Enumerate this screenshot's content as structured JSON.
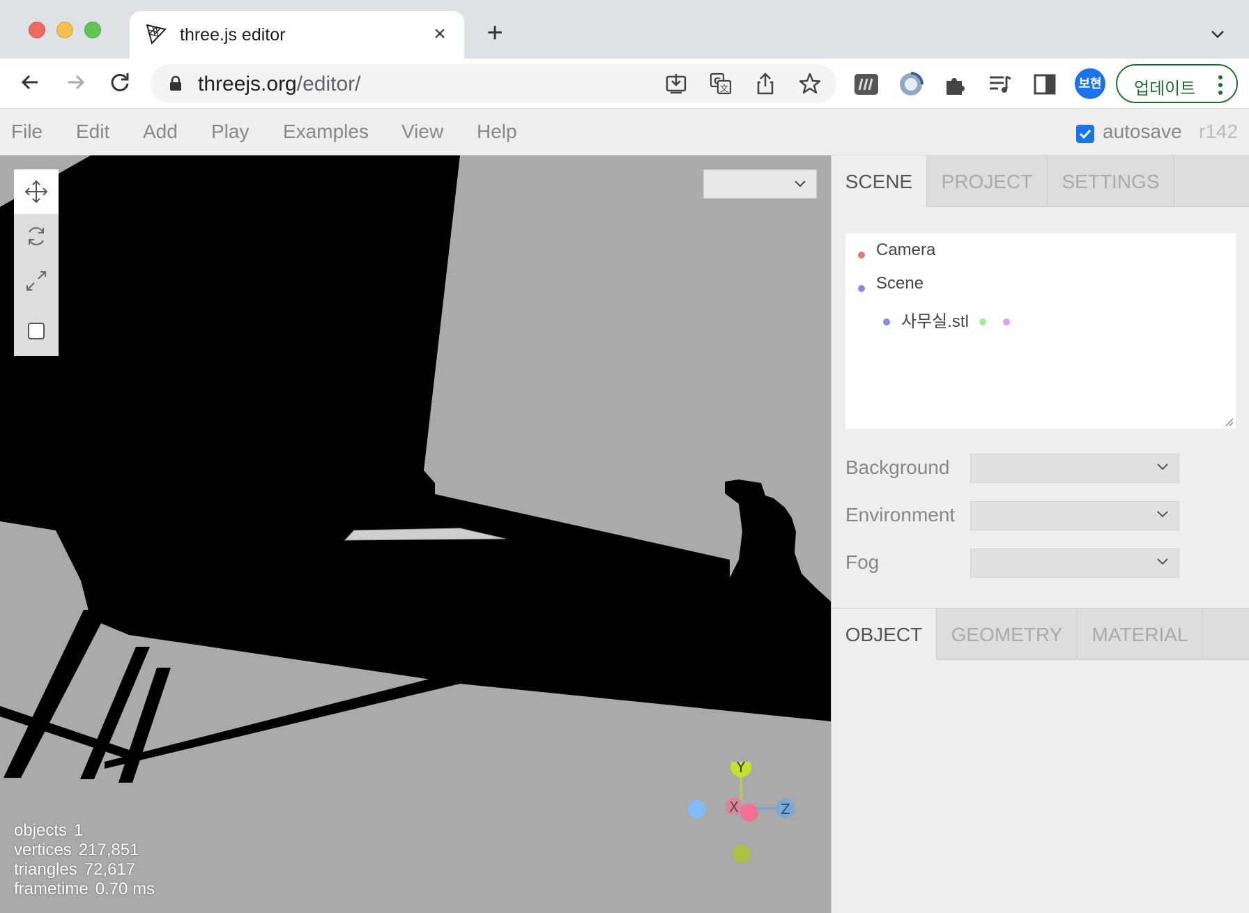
{
  "browser": {
    "tab_title": "three.js editor",
    "url_host": "threejs.org",
    "url_path": "/editor/",
    "profile_initials": "보현",
    "update_label": "업데이트"
  },
  "menu": {
    "items": [
      "File",
      "Edit",
      "Add",
      "Play",
      "Examples",
      "View",
      "Help"
    ],
    "autosave_label": "autosave",
    "autosave_checked": true,
    "revision": "r142"
  },
  "viewport": {
    "tools": [
      "translate",
      "rotate",
      "scale",
      "local"
    ],
    "camera_select_value": "",
    "info": [
      {
        "label": "objects",
        "value": "1"
      },
      {
        "label": "vertices",
        "value": "217,851"
      },
      {
        "label": "triangles",
        "value": "72,617"
      },
      {
        "label": "frametime",
        "value": "0.70 ms"
      }
    ],
    "gizmo": {
      "x_label": "X",
      "y_label": "Y",
      "z_label": "Z"
    }
  },
  "sidebar": {
    "top_tabs": [
      "SCENE",
      "PROJECT",
      "SETTINGS"
    ],
    "outliner": [
      {
        "label": "Camera",
        "dot_color": "#e07b7b"
      },
      {
        "label": "Scene",
        "dot_color": "#8888dd"
      },
      {
        "label": "사무실.stl",
        "dot_color": "#8888dd",
        "extra_dots": [
          "#a8e6a0",
          "#e0a0e8"
        ]
      }
    ],
    "properties": [
      {
        "label": "Background",
        "value": ""
      },
      {
        "label": "Environment",
        "value": ""
      },
      {
        "label": "Fog",
        "value": ""
      }
    ],
    "bottom_tabs": [
      "OBJECT",
      "GEOMETRY",
      "MATERIAL"
    ]
  },
  "colors": {
    "accent": "#1a73e8",
    "update_green": "#1e6b36",
    "viewport_bg": "#aaaaaa"
  }
}
